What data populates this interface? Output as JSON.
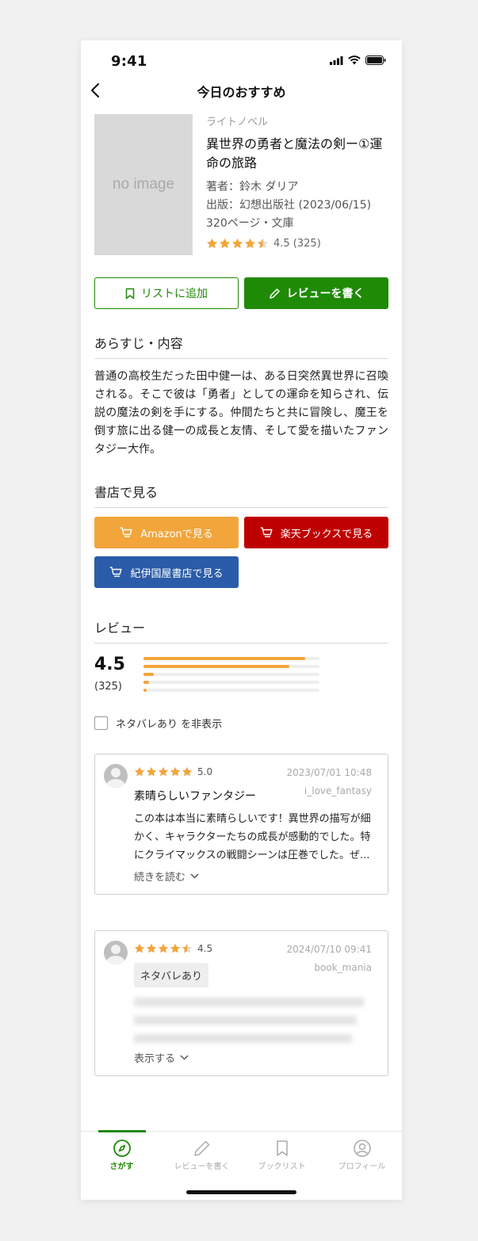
{
  "status": {
    "time": "9:41"
  },
  "nav": {
    "title": "今日のおすすめ"
  },
  "book": {
    "cover_text": "no image",
    "genre": "ライトノベル",
    "title": "異世界の勇者と魔法の剣ー①運命の旅路",
    "author": "著者：鈴木 ダリア",
    "publisher": "出版：幻想出版社 (2023/06/15)",
    "format": "320ページ・文庫",
    "rating_value": 4.5,
    "rating_text": "4.5 (325)"
  },
  "actions": {
    "add_list": "リストに追加",
    "write_review": "レビューを書く"
  },
  "synopsis": {
    "heading": "あらすじ・内容",
    "text": "普通の高校生だった田中健一は、ある日突然異世界に召喚される。そこで彼は「勇者」としての運命を知らされ、伝説の魔法の剣を手にする。仲間たちと共に冒険し、魔王を倒す旅に出る健一の成長と友情、そして愛を描いたファンタジー大作。"
  },
  "stores": {
    "heading": "書店で見る",
    "amazon": "Amazonで見る",
    "rakuten": "楽天ブックスで見る",
    "kinokuniya": "紀伊国屋書店で見る",
    "colors": {
      "amazon": "#f2a53b",
      "rakuten": "#bf0000",
      "kinokuniya": "#2a5ca9"
    }
  },
  "reviews": {
    "heading": "レビュー",
    "average": "4.5",
    "count": "(325)",
    "distribution": [
      {
        "stars": 5,
        "fraction": 0.92
      },
      {
        "stars": 4,
        "fraction": 0.83
      },
      {
        "stars": 3,
        "fraction": 0.06
      },
      {
        "stars": 2,
        "fraction": 0.03
      },
      {
        "stars": 1,
        "fraction": 0.02
      }
    ],
    "hide_spoilers": "ネタバレあり を非表示",
    "items": [
      {
        "rating": 5.0,
        "rating_text": "5.0",
        "date": "2023/07/01 10:48",
        "user": "i_love_fantasy",
        "title": "素晴らしいファンタジー",
        "body": "この本は本当に素晴らしいです！異世界の描写が細かく、キャラクターたちの成長が感動的でした。特にクライマックスの戦闘シーンは圧巻でした。ぜ...",
        "more": "続きを読む"
      },
      {
        "rating": 4.5,
        "rating_text": "4.5",
        "date": "2024/07/10 09:41",
        "user": "book_mania",
        "spoiler_tag": "ネタバレあり",
        "show": "表示する"
      }
    ]
  },
  "tabs": [
    {
      "label": "さがす",
      "icon": "compass-icon",
      "active": true
    },
    {
      "label": "レビューを書く",
      "icon": "pencil-icon",
      "active": false
    },
    {
      "label": "ブックリスト",
      "icon": "bookmark-icon",
      "active": false
    },
    {
      "label": "プロフィール",
      "icon": "user-circle-icon",
      "active": false
    }
  ],
  "colors": {
    "accent": "#1f8a06",
    "star": "#f2a53b"
  }
}
